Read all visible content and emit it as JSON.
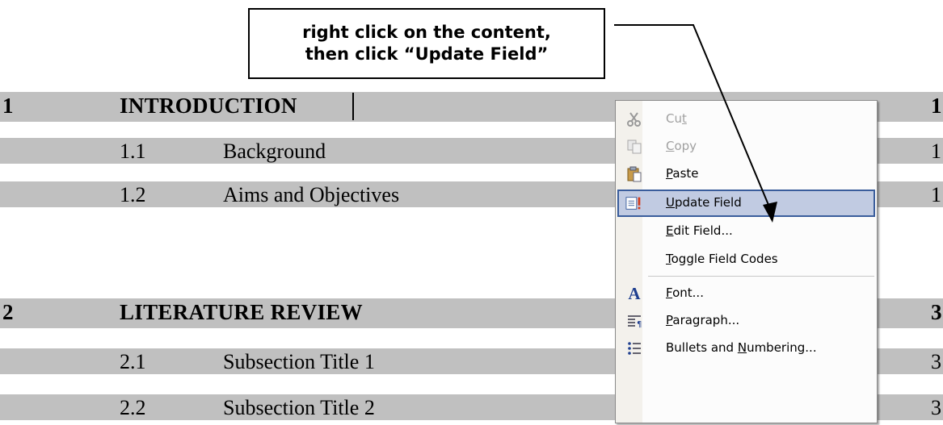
{
  "toc": [
    {
      "num": "1",
      "title": "INTRODUCTION",
      "page": "1",
      "level": 1
    },
    {
      "num": "1.1",
      "title": "Background",
      "page": "1",
      "level": 2
    },
    {
      "num": "1.2",
      "title": "Aims and Objectives",
      "page": "1",
      "level": 2
    },
    {
      "num": "2",
      "title": "LITERATURE REVIEW",
      "page": "3",
      "level": 1
    },
    {
      "num": "2.1",
      "title": "Subsection Title 1",
      "page": "3",
      "level": 2
    },
    {
      "num": "2.2",
      "title": "Subsection Title 2",
      "page": "3",
      "level": 2
    }
  ],
  "callout": {
    "line1": "right click on the content,",
    "line2": "then click “Update Field”"
  },
  "menu": {
    "items": [
      {
        "pre": "Cu",
        "key": "t",
        "post": "",
        "icon": "scissors-icon",
        "disabled": true
      },
      {
        "pre": "",
        "key": "C",
        "post": "opy",
        "icon": "copy-icon",
        "disabled": true
      },
      {
        "pre": "",
        "key": "P",
        "post": "aste",
        "icon": "paste-icon",
        "disabled": false
      },
      {
        "pre": "",
        "key": "U",
        "post": "pdate Field",
        "icon": "update-field-icon",
        "disabled": false,
        "highlighted": true
      },
      {
        "pre": "",
        "key": "E",
        "post": "dit Field...",
        "icon": "",
        "disabled": false
      },
      {
        "pre": "",
        "key": "T",
        "post": "oggle Field Codes",
        "icon": "",
        "disabled": false
      },
      {
        "pre": "",
        "key": "F",
        "post": "ont...",
        "icon": "font-icon",
        "disabled": false
      },
      {
        "pre": "",
        "key": "P",
        "post": "aragraph...",
        "icon": "paragraph-icon",
        "disabled": false
      },
      {
        "pre": "Bullets and ",
        "key": "N",
        "post": "umbering...",
        "icon": "bullets-icon",
        "disabled": false
      }
    ]
  },
  "colors": {
    "field_shading": "#c0c0c0",
    "menu_highlight": "#c1cbe2",
    "menu_highlight_border": "#3a5d9c",
    "disabled_text": "#a0a0a0"
  }
}
